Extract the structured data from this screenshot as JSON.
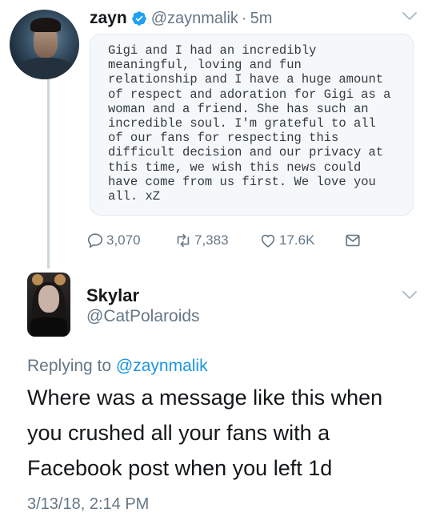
{
  "original_tweet": {
    "author_name": "zayn",
    "author_handle": "@zaynmalik",
    "separator": "·",
    "time_ago": "5m",
    "note_lines": [
      "Gigi and I had an incredibly",
      "meaningful, loving and fun",
      "relationship and I have a huge amount",
      "of respect and adoration for Gigi as a",
      "woman and a friend. She has such an",
      "incredible soul. I'm grateful to all",
      "of our fans for respecting this",
      "difficult decision and our privacy at",
      "this time, we wish this news could",
      "have come from us first. We love you",
      "all. xZ"
    ],
    "reply_count": "3,070",
    "retweet_count": "7,383",
    "like_count": "17.6K",
    "verified_color": "#1da1f2"
  },
  "reply_tweet": {
    "author_name": "Skylar",
    "author_handle": "@CatPolaroids",
    "replying_prefix": "Replying to",
    "replying_to": "@zaynmalik",
    "text": "Where was a message like this when you crushed all your fans with a Facebook post when you left 1d",
    "timestamp": "3/13/18, 2:14 PM"
  },
  "colors": {
    "secondary_text": "#657786",
    "link": "#1b95e0",
    "primary_text": "#14171a"
  }
}
